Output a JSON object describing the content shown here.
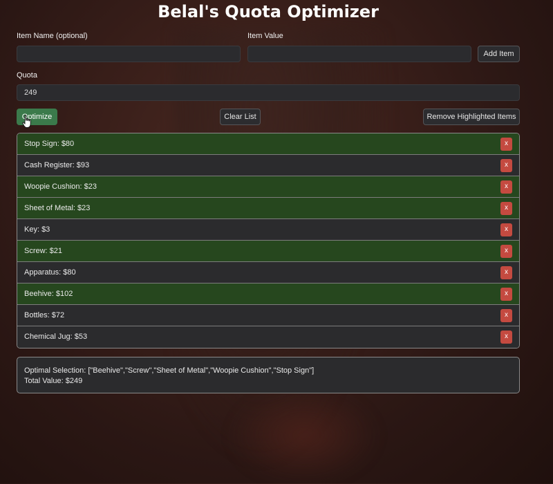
{
  "title": "Belal's Quota Optimizer",
  "form": {
    "item_name_label": "Item Name (optional)",
    "item_name_value": "",
    "item_value_label": "Item Value",
    "item_value_value": "",
    "add_item_label": "Add Item",
    "quota_label": "Quota",
    "quota_value": "249"
  },
  "actions": {
    "optimize_label": "Optimize",
    "clear_label": "Clear List",
    "remove_highlighted_label": "Remove Highlighted Items"
  },
  "items": [
    {
      "text": "Stop Sign: $80",
      "highlighted": true
    },
    {
      "text": "Cash Register: $93",
      "highlighted": false
    },
    {
      "text": "Woopie Cushion: $23",
      "highlighted": true
    },
    {
      "text": "Sheet of Metal: $23",
      "highlighted": true
    },
    {
      "text": "Key: $3",
      "highlighted": false
    },
    {
      "text": "Screw: $21",
      "highlighted": true
    },
    {
      "text": "Apparatus: $80",
      "highlighted": false
    },
    {
      "text": "Beehive: $102",
      "highlighted": true
    },
    {
      "text": "Bottles: $72",
      "highlighted": false
    },
    {
      "text": "Chemical Jug: $53",
      "highlighted": false
    }
  ],
  "delete_label": "x",
  "result": {
    "selection": "Optimal Selection: [\"Beehive\",\"Screw\",\"Sheet of Metal\",\"Woopie Cushion\",\"Stop Sign\"]",
    "total": "Total Value: $249"
  },
  "colors": {
    "highlight": "#26471e",
    "row": "#2b2b2d",
    "optimize_button": "#3b7a4b",
    "delete_button": "#c44a40"
  }
}
